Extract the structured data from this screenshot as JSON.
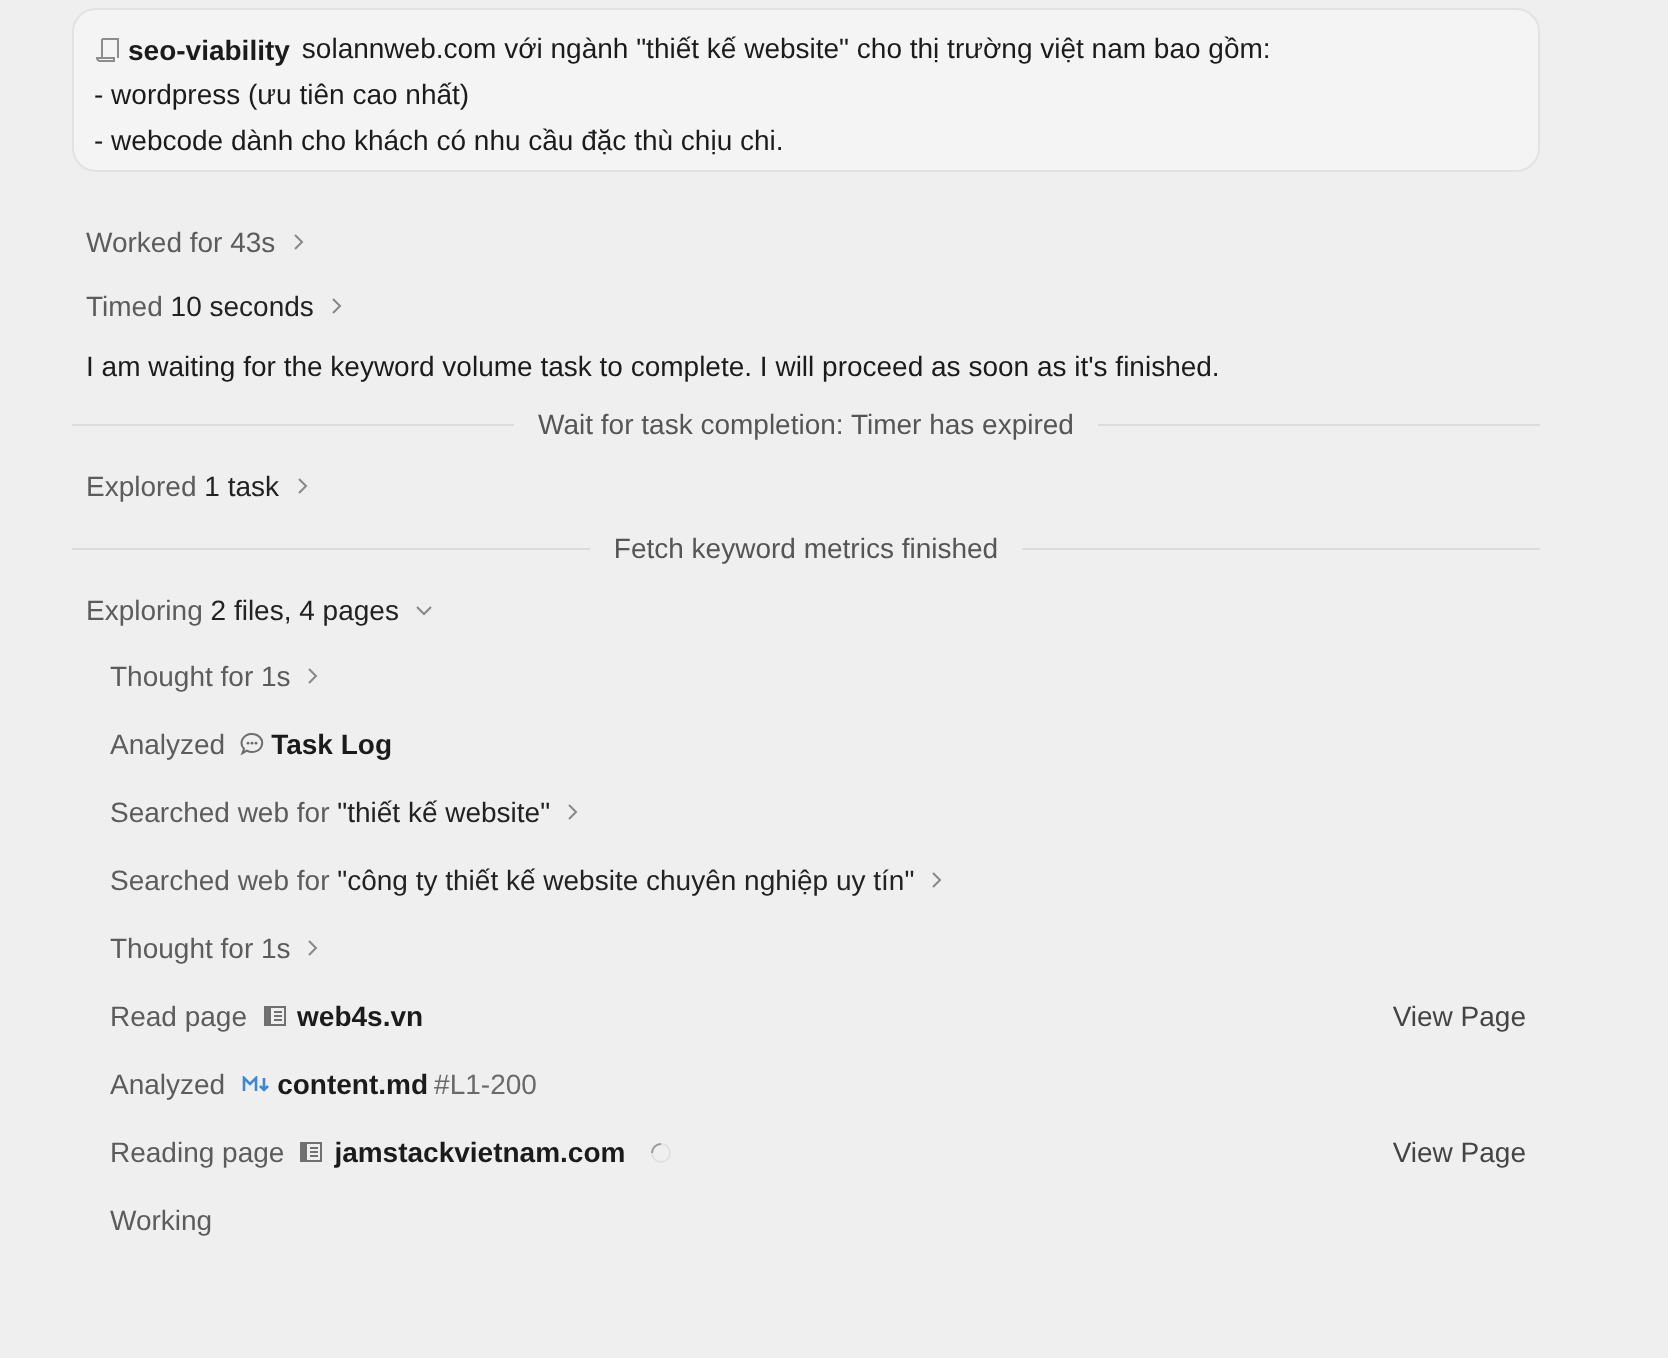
{
  "message": {
    "skill": "seo-viability",
    "lines": [
      "solannweb.com với ngành \"thiết kế website\" cho thị trường việt nam bao gồm:",
      "- wordpress (ưu tiên cao nhất)",
      "- webcode dành cho khách có nhu cầu đặc thù chịu chi."
    ]
  },
  "timeline": [
    {
      "kind": "step",
      "label": "Worked for 43s",
      "expanded": false
    },
    {
      "kind": "step",
      "label": "Timed",
      "detail": "10 seconds",
      "expanded": false
    },
    {
      "kind": "text",
      "text": "I am waiting for the keyword volume task to complete. I will proceed as soon as it's finished."
    },
    {
      "kind": "divider",
      "text": "Wait for task completion: Timer has expired"
    },
    {
      "kind": "step",
      "label": "Explored",
      "detail": "1 task",
      "expanded": false
    },
    {
      "kind": "divider",
      "text": "Fetch keyword metrics finished"
    },
    {
      "kind": "step",
      "label": "Exploring",
      "detail": "2 files, 4 pages",
      "expanded": true,
      "children": [
        {
          "kind": "step",
          "label": "Thought for 1s",
          "expanded": false
        },
        {
          "kind": "action",
          "label": "Analyzed",
          "target": {
            "kind": "log",
            "name": "Task Log"
          }
        },
        {
          "kind": "step",
          "label": "Searched web for",
          "detail": "\"thiết kế website\"",
          "expanded": false
        },
        {
          "kind": "step",
          "label": "Searched web for",
          "detail": "\"công ty thiết kế website chuyên nghiệp uy tín\"",
          "expanded": false
        },
        {
          "kind": "step",
          "label": "Thought for 1s",
          "expanded": false
        },
        {
          "kind": "action",
          "label": "Read page",
          "target": {
            "kind": "page",
            "name": "web4s.vn"
          },
          "link": "View Page"
        },
        {
          "kind": "action",
          "label": "Analyzed",
          "target": {
            "kind": "markdown",
            "name": "content.md",
            "suffix": "#L1-200"
          }
        },
        {
          "kind": "action",
          "label": "Reading page",
          "target": {
            "kind": "page",
            "name": "jamstackvietnam.com"
          },
          "loading": true,
          "link": "View Page"
        },
        {
          "kind": "status",
          "text": "Working"
        }
      ]
    }
  ]
}
